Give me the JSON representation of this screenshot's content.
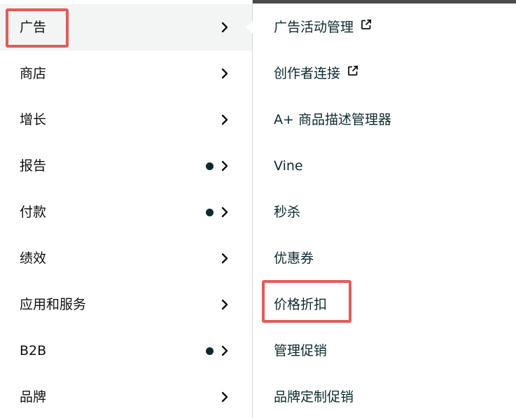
{
  "left_menu": {
    "items": [
      {
        "label": "广告",
        "dot": false,
        "active": true
      },
      {
        "label": "商店",
        "dot": false,
        "active": false
      },
      {
        "label": "增长",
        "dot": false,
        "active": false
      },
      {
        "label": "报告",
        "dot": true,
        "active": false
      },
      {
        "label": "付款",
        "dot": true,
        "active": false
      },
      {
        "label": "绩效",
        "dot": false,
        "active": false
      },
      {
        "label": "应用和服务",
        "dot": false,
        "active": false
      },
      {
        "label": "B2B",
        "dot": true,
        "active": false
      },
      {
        "label": "品牌",
        "dot": false,
        "active": false
      }
    ]
  },
  "sub_menu": {
    "items": [
      {
        "label": "广告活动管理",
        "external": true
      },
      {
        "label": "创作者连接",
        "external": true
      },
      {
        "label": "A+ 商品描述管理器",
        "external": false
      },
      {
        "label": "Vine",
        "external": false
      },
      {
        "label": "秒杀",
        "external": false
      },
      {
        "label": "优惠券",
        "external": false
      },
      {
        "label": "价格折扣",
        "external": false
      },
      {
        "label": "管理促销",
        "external": false
      },
      {
        "label": "品牌定制促销",
        "external": false
      }
    ]
  },
  "icons": {
    "chevron": "chevron-right-icon",
    "external": "external-link-icon",
    "dot": "notification-dot-icon"
  },
  "colors": {
    "highlight": "#e55a5a",
    "active_bg": "#f3f4f4",
    "dot": "#0d2b2f",
    "top_bar": "#4a4a4a"
  }
}
